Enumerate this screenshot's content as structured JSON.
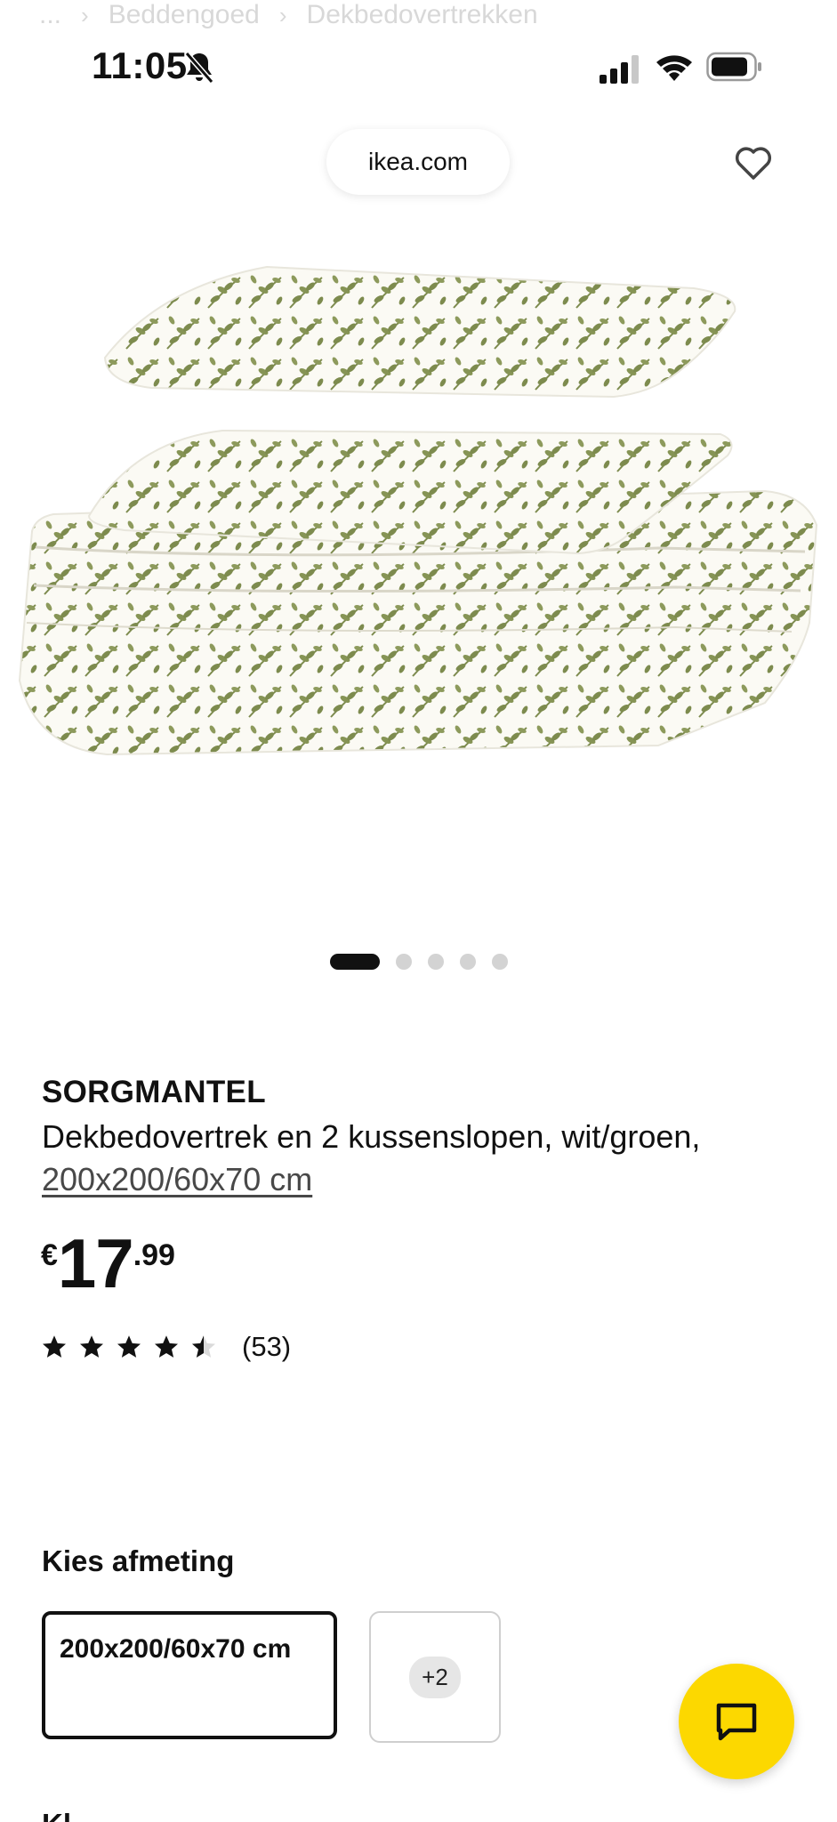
{
  "breadcrumb": {
    "ellipsis": "...",
    "items": [
      "Beddengoed",
      "Dekbedovertrekken"
    ]
  },
  "status_bar": {
    "time": "11:05"
  },
  "browser": {
    "url": "ikea.com"
  },
  "carousel": {
    "total": 5,
    "active_index": 0
  },
  "product": {
    "name": "SORGMANTEL",
    "description": "Dekbedovertrek en 2 kussenslopen, wit/groen,",
    "size_text": "200x200/60x70 cm",
    "price_currency": "€",
    "price_whole": "17",
    "price_decimals": ".99",
    "rating": 4.5,
    "rating_count": "(53)"
  },
  "size_selector": {
    "label": "Kies afmeting",
    "selected": "200x200/60x70 cm",
    "more_badge": "+2"
  },
  "next_section": {
    "label": "Kl"
  },
  "colors": {
    "ikea_yellow": "#fcd800",
    "pattern_green": "#7d8b4e"
  },
  "icons": {
    "silent": "bell-slash-icon",
    "favorite": "heart-icon",
    "chat": "chat-bubble-icon"
  }
}
